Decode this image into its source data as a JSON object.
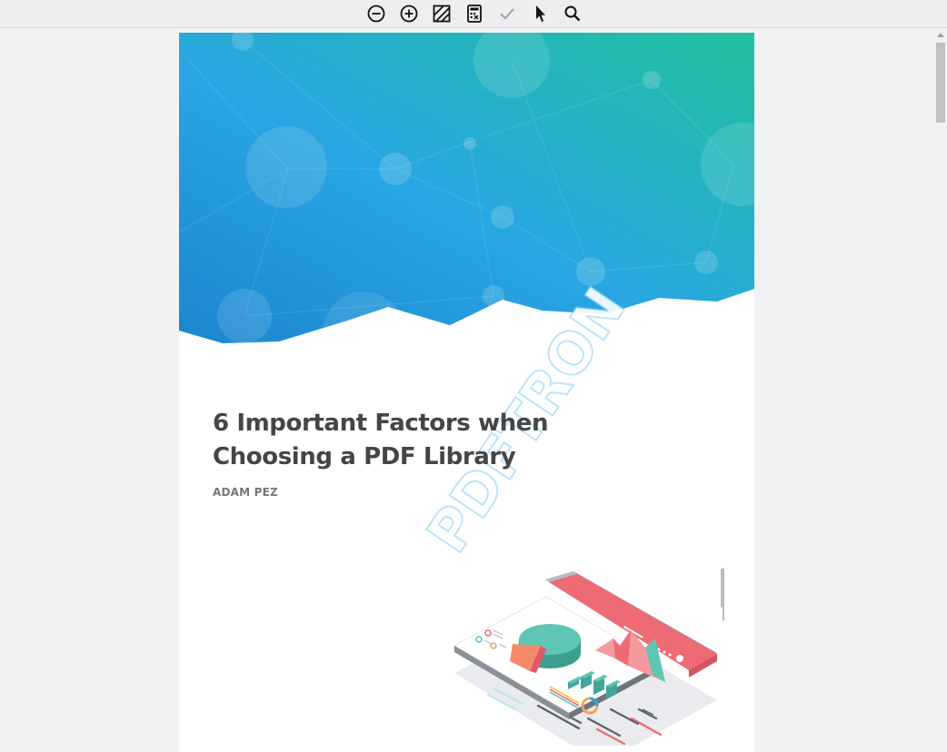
{
  "toolbar": {
    "tools": [
      {
        "name": "zoom-out",
        "icon": "minus-circle-icon"
      },
      {
        "name": "zoom-in",
        "icon": "plus-circle-icon"
      },
      {
        "name": "redaction",
        "icon": "hatched-square-icon"
      },
      {
        "name": "apply-redaction",
        "icon": "calculator-icon"
      },
      {
        "name": "check",
        "icon": "checkmark-icon"
      },
      {
        "name": "select",
        "icon": "pointer-arrow-icon"
      },
      {
        "name": "search",
        "icon": "magnifier-icon"
      }
    ]
  },
  "document": {
    "title_line1": "6 Important Factors when",
    "title_line2": "Choosing a PDF Library",
    "author": "ADAM PEZ",
    "watermark": "PDFTRON"
  },
  "colors": {
    "hero_blue": "#2aa3e0",
    "hero_teal": "#25bfa3",
    "title_text": "#454545",
    "author_text": "#767676",
    "accent_red": "#ee6a74",
    "accent_teal": "#5fc6b4"
  }
}
